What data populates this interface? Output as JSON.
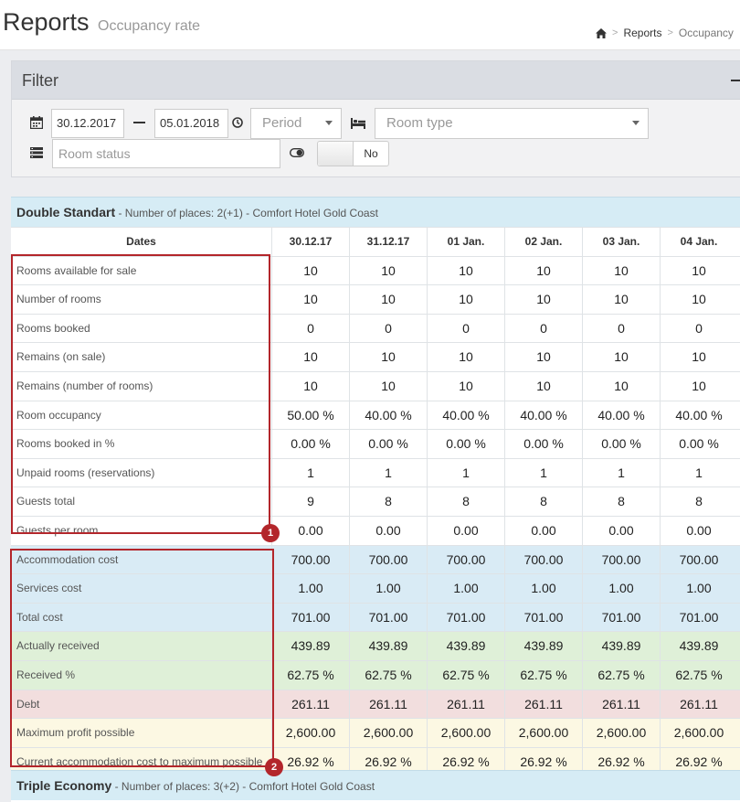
{
  "header": {
    "title": "Reports",
    "subtitle": "Occupancy rate",
    "breadcrumb": [
      "Reports",
      "Occupancy"
    ]
  },
  "filter": {
    "title": "Filter",
    "date_from": "30.12.2017",
    "date_to": "05.01.2018",
    "period_placeholder": "Period",
    "room_type_placeholder": "Room type",
    "room_status_placeholder": "Room status",
    "toggle_value": "No"
  },
  "table": {
    "room": {
      "name": "Double Standart",
      "meta": " - Number of places: 2(+1) - Comfort Hotel Gold Coast"
    },
    "dates_label": "Dates",
    "dates": [
      "30.12.17",
      "31.12.17",
      "01 Jan.",
      "02 Jan.",
      "03 Jan.",
      "04 Jan."
    ],
    "rows": [
      {
        "label": "Rooms available for sale",
        "tone": "white",
        "values": [
          "10",
          "10",
          "10",
          "10",
          "10",
          "10"
        ]
      },
      {
        "label": "Number of rooms",
        "tone": "white",
        "values": [
          "10",
          "10",
          "10",
          "10",
          "10",
          "10"
        ]
      },
      {
        "label": "Rooms booked",
        "tone": "white",
        "values": [
          "0",
          "0",
          "0",
          "0",
          "0",
          "0"
        ]
      },
      {
        "label": "Remains (on sale)",
        "tone": "white",
        "values": [
          "10",
          "10",
          "10",
          "10",
          "10",
          "10"
        ]
      },
      {
        "label": "Remains (number of rooms)",
        "tone": "white",
        "values": [
          "10",
          "10",
          "10",
          "10",
          "10",
          "10"
        ]
      },
      {
        "label": "Room occupancy",
        "tone": "white",
        "values": [
          "50.00 %",
          "40.00 %",
          "40.00 %",
          "40.00 %",
          "40.00 %",
          "40.00 %"
        ]
      },
      {
        "label": "Rooms booked in %",
        "tone": "white",
        "values": [
          "0.00 %",
          "0.00 %",
          "0.00 %",
          "0.00 %",
          "0.00 %",
          "0.00 %"
        ]
      },
      {
        "label": "Unpaid rooms (reservations)",
        "tone": "white",
        "values": [
          "1",
          "1",
          "1",
          "1",
          "1",
          "1"
        ]
      },
      {
        "label": "Guests total",
        "tone": "white",
        "values": [
          "9",
          "8",
          "8",
          "8",
          "8",
          "8"
        ]
      },
      {
        "label": "Guests per room",
        "tone": "white",
        "values": [
          "0.00",
          "0.00",
          "0.00",
          "0.00",
          "0.00",
          "0.00"
        ]
      },
      {
        "label": "Accommodation cost",
        "tone": "blue",
        "values": [
          "700.00",
          "700.00",
          "700.00",
          "700.00",
          "700.00",
          "700.00"
        ]
      },
      {
        "label": "Services cost",
        "tone": "blue",
        "values": [
          "1.00",
          "1.00",
          "1.00",
          "1.00",
          "1.00",
          "1.00"
        ]
      },
      {
        "label": "Total cost",
        "tone": "blue",
        "values": [
          "701.00",
          "701.00",
          "701.00",
          "701.00",
          "701.00",
          "701.00"
        ]
      },
      {
        "label": "Actually received",
        "tone": "green",
        "values": [
          "439.89",
          "439.89",
          "439.89",
          "439.89",
          "439.89",
          "439.89"
        ]
      },
      {
        "label": "Received %",
        "tone": "green",
        "values": [
          "62.75 %",
          "62.75 %",
          "62.75 %",
          "62.75 %",
          "62.75 %",
          "62.75 %"
        ]
      },
      {
        "label": "Debt",
        "tone": "red",
        "values": [
          "261.11",
          "261.11",
          "261.11",
          "261.11",
          "261.11",
          "261.11"
        ]
      },
      {
        "label": "Maximum profit possible",
        "tone": "yellow",
        "values": [
          "2,600.00",
          "2,600.00",
          "2,600.00",
          "2,600.00",
          "2,600.00",
          "2,600.00"
        ]
      },
      {
        "label": "Current accommodation cost to maximum possible",
        "tone": "yellow",
        "values": [
          "26.92 %",
          "26.92 %",
          "26.92 %",
          "26.92 %",
          "26.92 %",
          "26.92 %"
        ]
      }
    ],
    "next_room": {
      "name": "Triple Economy",
      "meta": " - Number of places: 3(+2) - Comfort Hotel Gold Coast"
    }
  },
  "annotations": [
    {
      "number": "1"
    },
    {
      "number": "2"
    }
  ]
}
